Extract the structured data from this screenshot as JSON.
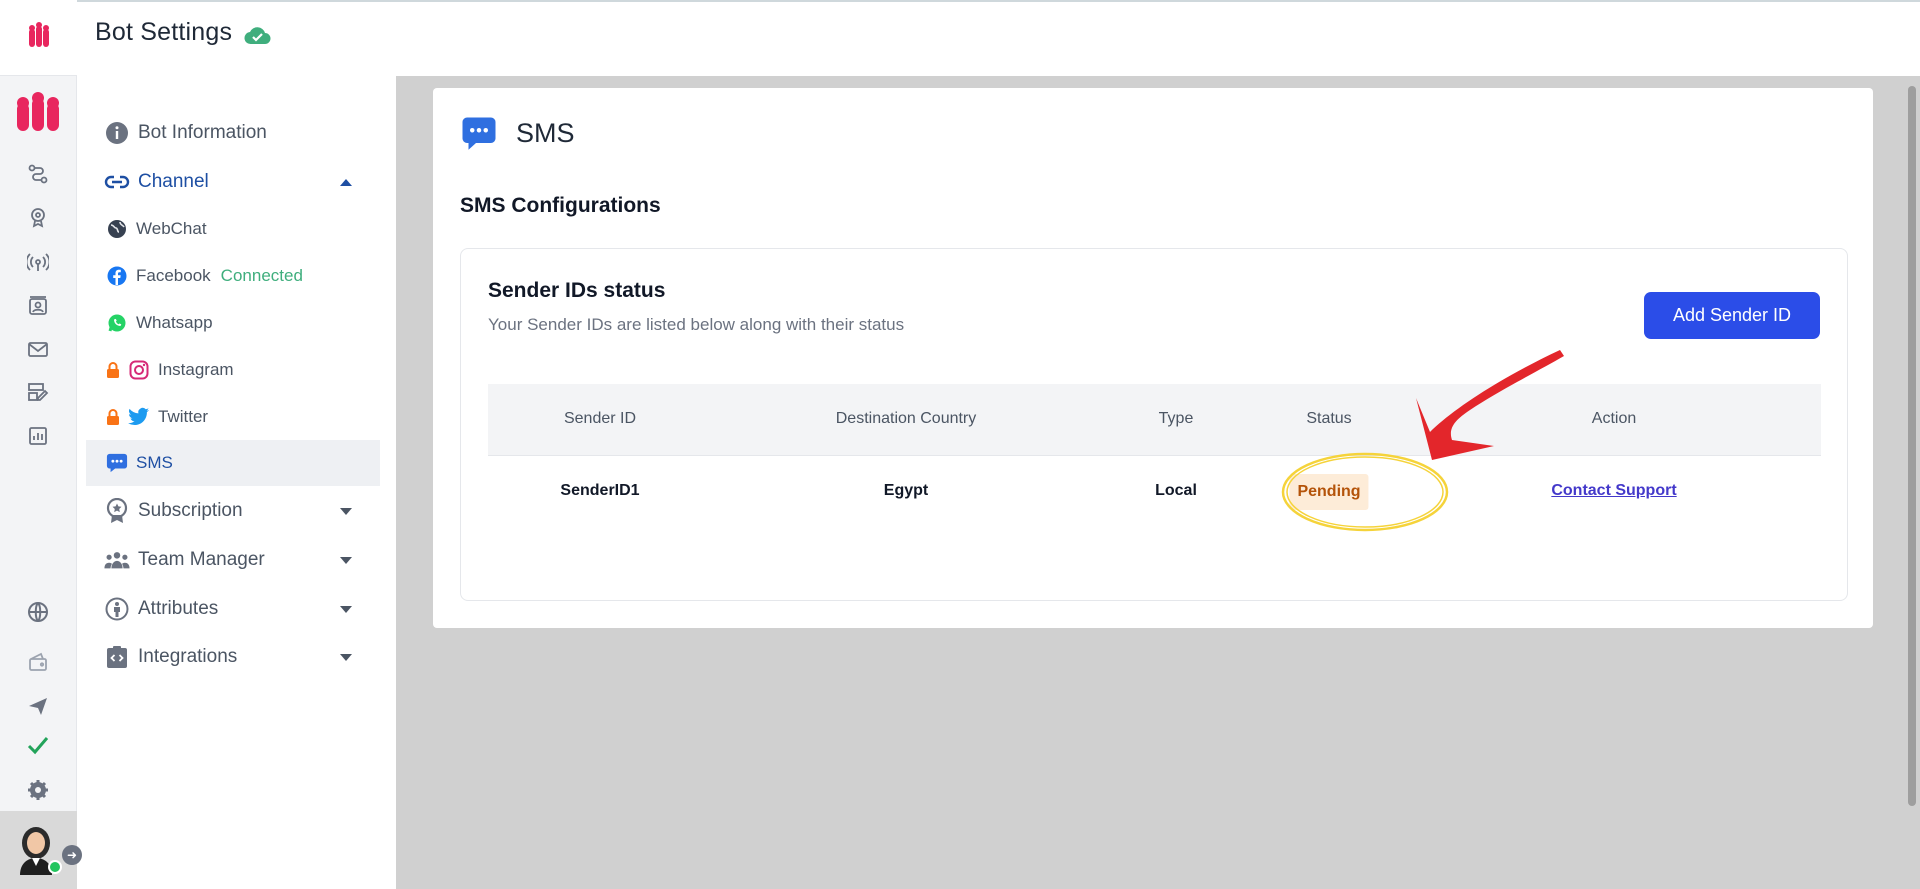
{
  "header": {
    "title": "Bot Settings",
    "status_icon": "cloud-check-icon"
  },
  "rail": {
    "icons": [
      "app-logo-icon",
      "brand-logo-icon",
      "flow-icon",
      "training-icon",
      "broadcast-icon",
      "contacts-icon",
      "mail-icon",
      "templates-icon",
      "analytics-icon",
      "globe-icon",
      "wallet-icon",
      "send-icon",
      "check-icon",
      "gear-icon"
    ]
  },
  "menu": {
    "bot_information": "Bot Information",
    "channel": "Channel",
    "channels": {
      "webchat": "WebChat",
      "facebook": "Facebook",
      "facebook_status": "Connected",
      "whatsapp": "Whatsapp",
      "instagram": "Instagram",
      "twitter": "Twitter",
      "sms": "SMS"
    },
    "subscription": "Subscription",
    "team_manager": "Team Manager",
    "attributes": "Attributes",
    "integrations": "Integrations"
  },
  "main": {
    "title": "SMS",
    "section_title": "SMS Configurations",
    "panel": {
      "title": "Sender IDs status",
      "subtitle": "Your Sender IDs are listed below along with their status",
      "add_button": "Add Sender ID",
      "columns": [
        "Sender ID",
        "Destination Country",
        "Type",
        "Status",
        "Action"
      ],
      "rows": [
        {
          "sender_id": "SenderID1",
          "country": "Egypt",
          "type": "Local",
          "status": "Pending",
          "action": "Contact Support"
        }
      ]
    }
  },
  "colors": {
    "accent": "#2b4de8",
    "brand": "#e8265e",
    "pending_bg": "#fdecd8",
    "pending_text": "#b45309",
    "annotation": "#e3262b"
  }
}
